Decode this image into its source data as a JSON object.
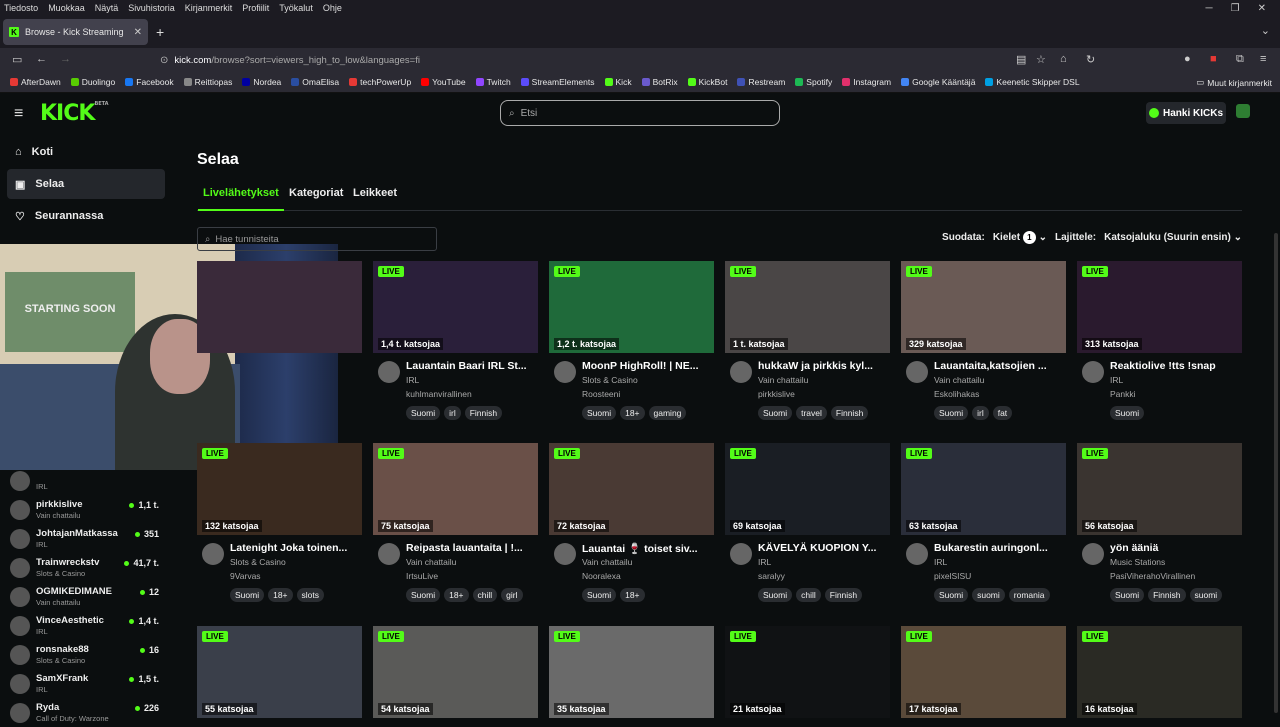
{
  "browser": {
    "menu": [
      "Tiedosto",
      "Muokkaa",
      "Näytä",
      "Sivuhistoria",
      "Kirjanmerkit",
      "Profiilit",
      "Työkalut",
      "Ohje"
    ],
    "tab_title": "Browse - Kick Streaming",
    "url_host": "kick.com",
    "url_path": "/browse?sort=viewers_high_to_low&languages=fi",
    "bookmarks": [
      {
        "label": "AfterDawn",
        "color": "#e53935"
      },
      {
        "label": "Duolingo",
        "color": "#58cc02"
      },
      {
        "label": "Facebook",
        "color": "#1877f2"
      },
      {
        "label": "Reittiopas",
        "color": "#888888"
      },
      {
        "label": "Nordea",
        "color": "#0000a0"
      },
      {
        "label": "OmaElisa",
        "color": "#2a4ea1"
      },
      {
        "label": "techPowerUp",
        "color": "#e53935"
      },
      {
        "label": "YouTube",
        "color": "#ff0000"
      },
      {
        "label": "Twitch",
        "color": "#9146ff"
      },
      {
        "label": "StreamElements",
        "color": "#5b4cfa"
      },
      {
        "label": "Kick",
        "color": "#53fc18"
      },
      {
        "label": "BotRix",
        "color": "#6a5acd"
      },
      {
        "label": "KickBot",
        "color": "#53fc18"
      },
      {
        "label": "Restream",
        "color": "#3f51b5"
      },
      {
        "label": "Spotify",
        "color": "#1db954"
      },
      {
        "label": "Instagram",
        "color": "#e1306c"
      },
      {
        "label": "Google Kääntäjä",
        "color": "#4285f4"
      },
      {
        "label": "Keenetic Skipper DSL",
        "color": "#00a0e3"
      }
    ],
    "other_bookmarks": "Muut kirjanmerkit"
  },
  "header": {
    "logo": "KICK",
    "beta": "BETA",
    "search_placeholder": "Etsi",
    "get_kicks": "Hanki KICKs"
  },
  "sidebar": {
    "nav": [
      {
        "label": "Koti",
        "icon": "home-icon"
      },
      {
        "label": "Selaa",
        "icon": "browse-icon"
      },
      {
        "label": "Seurannassa",
        "icon": "heart-icon"
      }
    ],
    "channels": [
      {
        "name": "",
        "category": "IRL",
        "viewers": ""
      },
      {
        "name": "pirkkislive",
        "category": "Vain chattailu",
        "viewers": "1,1 t."
      },
      {
        "name": "JohtajanMatkassa",
        "category": "IRL",
        "viewers": "351"
      },
      {
        "name": "Trainwreckstv",
        "category": "Slots & Casino",
        "viewers": "41,7 t."
      },
      {
        "name": "OGMIKEDIMANE",
        "category": "Vain chattailu",
        "viewers": "12"
      },
      {
        "name": "VinceAesthetic",
        "category": "IRL",
        "viewers": "1,4 t."
      },
      {
        "name": "ronsnake88",
        "category": "Slots & Casino",
        "viewers": "16"
      },
      {
        "name": "SamXFrank",
        "category": "IRL",
        "viewers": "1,5 t."
      },
      {
        "name": "Ryda",
        "category": "Call of Duty: Warzone",
        "viewers": "226"
      }
    ]
  },
  "webcam": {
    "poster_text": "STARTING SOON"
  },
  "main": {
    "title": "Selaa",
    "tabs": [
      "Livelähetykset",
      "Kategoriat",
      "Leikkeet"
    ],
    "filter_placeholder": "Hae tunnisteita",
    "filter_label": "Suodata:",
    "languages_label": "Kielet",
    "languages_count": "1",
    "sort_label": "Lajittele:",
    "sort_value": "Katsojaluku (Suurin ensin)",
    "live_badge": "LIVE",
    "cards": [
      {
        "viewers": "",
        "title": "",
        "category": "",
        "channel": "",
        "tags": [],
        "bg": "#3a2a3a"
      },
      {
        "viewers": "1,4 t. katsojaa",
        "title": "Lauantain Baari IRL St...",
        "category": "IRL",
        "channel": "kuhlmanvirallinen",
        "tags": [
          "Suomi",
          "irl",
          "Finnish"
        ],
        "bg": "#2a1f3a"
      },
      {
        "viewers": "1,2 t. katsojaa",
        "title": "MoonP HighRoll! | NE...",
        "category": "Slots & Casino",
        "channel": "Roosteeni",
        "tags": [
          "Suomi",
          "18+",
          "gaming"
        ],
        "bg": "#1f6a3a"
      },
      {
        "viewers": "1 t. katsojaa",
        "title": "hukkaW ja pirkkis kyl...",
        "category": "Vain chattailu",
        "channel": "pirkkislive",
        "tags": [
          "Suomi",
          "travel",
          "Finnish"
        ],
        "bg": "#4a4646"
      },
      {
        "viewers": "329 katsojaa",
        "title": "Lauantaita,katsojien ...",
        "category": "Vain chattailu",
        "channel": "Eskolihakas",
        "tags": [
          "Suomi",
          "irl",
          "fat"
        ],
        "bg": "#6a5a55"
      },
      {
        "viewers": "313 katsojaa",
        "title": "Reaktiolive !tts !snap",
        "category": "IRL",
        "channel": "Pankki",
        "tags": [
          "Suomi"
        ],
        "bg": "#2a1a2e"
      },
      {
        "viewers": "132 katsojaa",
        "title": "Latenight Joka toinen...",
        "category": "Slots & Casino",
        "channel": "9Varvas",
        "tags": [
          "Suomi",
          "18+",
          "slots"
        ],
        "bg": "#3a2a1f"
      },
      {
        "viewers": "75 katsojaa",
        "title": "Reipasta lauantaita | !...",
        "category": "Vain chattailu",
        "channel": "IrtsuLive",
        "tags": [
          "Suomi",
          "18+",
          "chill",
          "girl"
        ],
        "bg": "#6a5048"
      },
      {
        "viewers": "72 katsojaa",
        "title": "Lauantai 🍷 toiset siv...",
        "category": "Vain chattailu",
        "channel": "Nooralexa",
        "tags": [
          "Suomi",
          "18+"
        ],
        "bg": "#4a3a34"
      },
      {
        "viewers": "69 katsojaa",
        "title": "KÄVELYÄ KUOPION Y...",
        "category": "IRL",
        "channel": "saralyy",
        "tags": [
          "Suomi",
          "chill",
          "Finnish"
        ],
        "bg": "#1a1e24"
      },
      {
        "viewers": "63 katsojaa",
        "title": "Bukarestin auringonl...",
        "category": "IRL",
        "channel": "pixelSISU",
        "tags": [
          "Suomi",
          "suomi",
          "romania"
        ],
        "bg": "#2a2e3a"
      },
      {
        "viewers": "56 katsojaa",
        "title": "yön ääniä",
        "category": "Music Stations",
        "channel": "PasiViherahoVirallinen",
        "tags": [
          "Suomi",
          "Finnish",
          "suomi"
        ],
        "bg": "#3a3430"
      },
      {
        "viewers": "55 katsojaa",
        "title": "",
        "category": "",
        "channel": "",
        "tags": [],
        "bg": "#3a3f4a"
      },
      {
        "viewers": "54 katsojaa",
        "title": "",
        "category": "",
        "channel": "",
        "tags": [],
        "bg": "#5a5a58"
      },
      {
        "viewers": "35 katsojaa",
        "title": "",
        "category": "",
        "channel": "",
        "tags": [],
        "bg": "#6a6a6a"
      },
      {
        "viewers": "21 katsojaa",
        "title": "",
        "category": "",
        "channel": "",
        "tags": [],
        "bg": "#101214"
      },
      {
        "viewers": "17 katsojaa",
        "title": "",
        "category": "",
        "channel": "",
        "tags": [],
        "bg": "#5a4a3a"
      },
      {
        "viewers": "16 katsojaa",
        "title": "",
        "category": "",
        "channel": "",
        "tags": [],
        "bg": "#2a2a24"
      }
    ]
  }
}
